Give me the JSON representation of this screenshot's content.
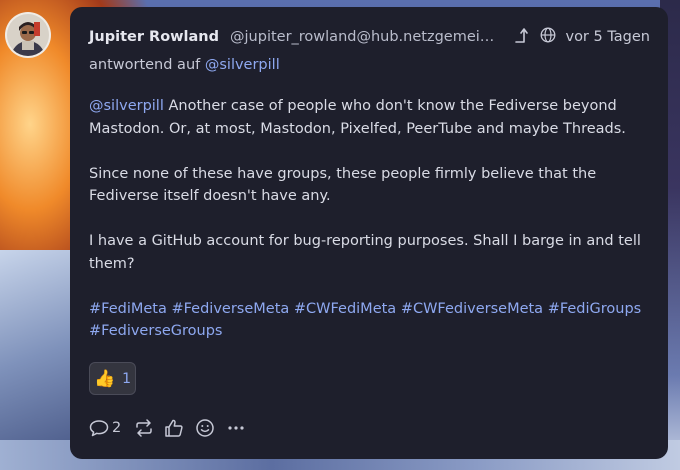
{
  "post": {
    "author": "Jupiter Rowland",
    "handle": "@jupiter_rowland@hub.netzgemeinde...",
    "time": "vor 5 Tagen",
    "in_reply_prefix": "antwortend auf",
    "in_reply_to": "@silverpill",
    "paragraphs": [
      {
        "mention": "@silverpill",
        "text": " Another case of people who don't know the Fediverse beyond Mastodon. Or, at most, Mastodon, Pixelfed, PeerTube and maybe Threads."
      },
      {
        "text": "Since none of these have groups, these people firmly believe that the Fediverse itself doesn't have any."
      },
      {
        "text": "I have a GitHub account for bug-reporting purposes. Shall I barge in and tell them?"
      }
    ],
    "hashtags": [
      "#FediMeta",
      "#FediverseMeta",
      "#CWFediMeta",
      "#CWFediverseMeta",
      "#FediGroups",
      "#FediverseGroups"
    ],
    "reaction": {
      "emoji": "👍",
      "count": "1"
    },
    "actions": {
      "reply_count": "2"
    }
  },
  "icons": [
    "avatar",
    "reply-parent-icon",
    "globe-icon",
    "reply-icon",
    "boost-icon",
    "like-icon",
    "emoji-react-icon",
    "more-icon"
  ],
  "colors": {
    "card": "#1e1f2c",
    "link": "#8ea8f0",
    "text": "#d9dbe5"
  }
}
